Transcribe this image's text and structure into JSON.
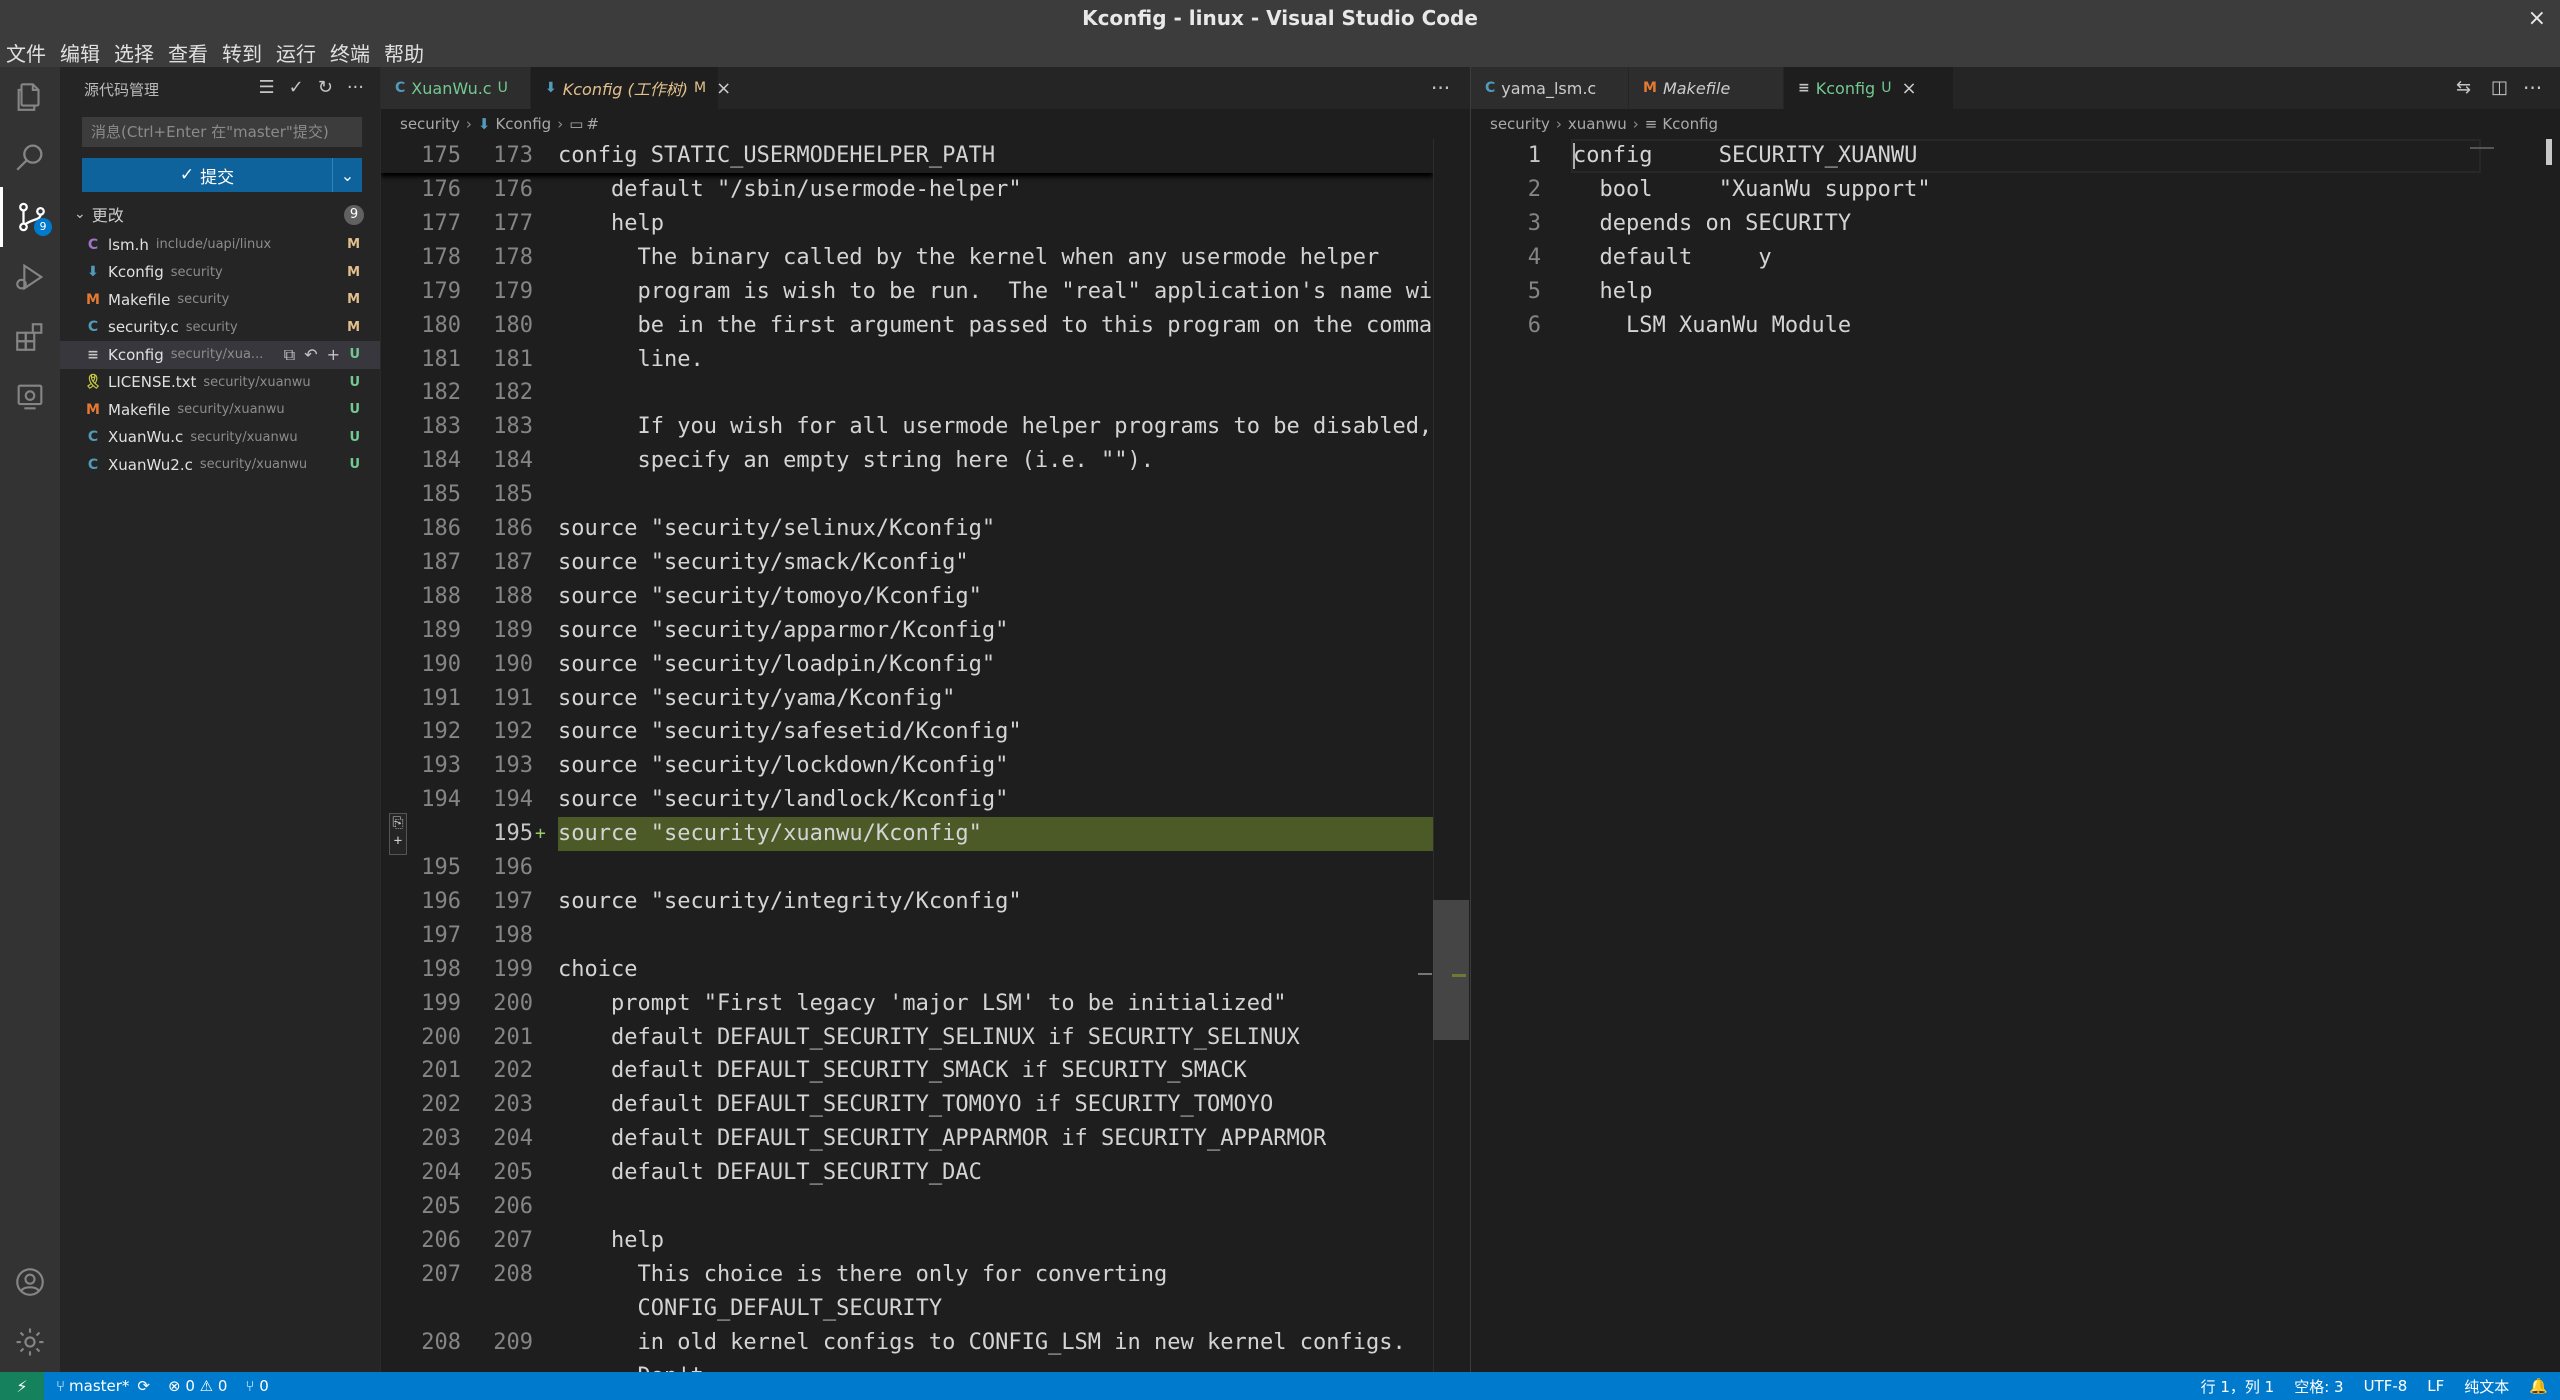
{
  "window": {
    "title": "Kconfig - linux - Visual Studio Code",
    "close_glyph": "×"
  },
  "menu": [
    "文件",
    "编辑",
    "选择",
    "查看",
    "转到",
    "运行",
    "终端",
    "帮助"
  ],
  "activity": {
    "items": [
      {
        "name": "explorer-icon"
      },
      {
        "name": "search-icon"
      },
      {
        "name": "source-control-icon",
        "badge": "9"
      },
      {
        "name": "run-debug-icon"
      },
      {
        "name": "extensions-icon"
      },
      {
        "name": "remote-explorer-icon"
      }
    ],
    "bottom": [
      {
        "name": "account-icon"
      },
      {
        "name": "manage-gear-icon"
      }
    ]
  },
  "scm": {
    "title": "源代码管理",
    "message_placeholder": "消息(Ctrl+Enter 在\"master\"提交)",
    "commit_label": "提交",
    "commit_check": "✓",
    "changes_label": "更改",
    "changes_count": "9",
    "files": [
      {
        "icon": "C",
        "icon_color": "#a074c4",
        "name": "lsm.h",
        "dir": "include/uapi/linux",
        "status": "M"
      },
      {
        "icon": "⬇",
        "icon_color": "#519aba",
        "name": "Kconfig",
        "dir": "security",
        "status": "M"
      },
      {
        "icon": "M",
        "icon_color": "#e37933",
        "name": "Makefile",
        "dir": "security",
        "status": "M"
      },
      {
        "icon": "C",
        "icon_color": "#519aba",
        "name": "security.c",
        "dir": "security",
        "status": "M"
      },
      {
        "icon": "≡",
        "icon_color": "#c5c5c5",
        "name": "Kconfig",
        "dir": "security/xua...",
        "status": "U",
        "selected": true
      },
      {
        "icon": "🎗",
        "icon_color": "#cbcb41",
        "name": "LICENSE.txt",
        "dir": "security/xuanwu",
        "status": "U"
      },
      {
        "icon": "M",
        "icon_color": "#e37933",
        "name": "Makefile",
        "dir": "security/xuanwu",
        "status": "U"
      },
      {
        "icon": "C",
        "icon_color": "#519aba",
        "name": "XuanWu.c",
        "dir": "security/xuanwu",
        "status": "U"
      },
      {
        "icon": "C",
        "icon_color": "#519aba",
        "name": "XuanWu2.c",
        "dir": "security/xuanwu",
        "status": "U"
      }
    ]
  },
  "left_group": {
    "tabs": [
      {
        "icon": "C",
        "icon_color": "#519aba",
        "label": "XuanWu.c",
        "status": "U",
        "status_color": "#73c991",
        "label_color": "#73c991"
      },
      {
        "icon": "⬇",
        "icon_color": "#519aba",
        "label": "Kconfig (工作树)",
        "status": "M",
        "status_color": "#e2c08d",
        "label_color": "#e2c08d",
        "active": true,
        "italic": true
      }
    ],
    "more": "···",
    "breadcrumbs": [
      "security",
      "Kconfig",
      "#"
    ],
    "sticky": {
      "left": "175",
      "right": "173",
      "code": "config STATIC_USERMODEHELPER_PATH"
    },
    "lines": [
      {
        "l": "176",
        "r": "176",
        "code": "    default \"/sbin/usermode-helper\""
      },
      {
        "l": "177",
        "r": "177",
        "code": "    help"
      },
      {
        "l": "178",
        "r": "178",
        "code": "      The binary called by the kernel when any usermode helper"
      },
      {
        "l": "179",
        "r": "179",
        "code": "      program is wish to be run.  The \"real\" application's name will"
      },
      {
        "l": "180",
        "r": "180",
        "code": "      be in the first argument passed to this program on the command"
      },
      {
        "l": "181",
        "r": "181",
        "code": "      line."
      },
      {
        "l": "182",
        "r": "182",
        "code": ""
      },
      {
        "l": "183",
        "r": "183",
        "code": "      If you wish for all usermode helper programs to be disabled,"
      },
      {
        "l": "184",
        "r": "184",
        "code": "      specify an empty string here (i.e. \"\")."
      },
      {
        "l": "185",
        "r": "185",
        "code": ""
      },
      {
        "l": "186",
        "r": "186",
        "code": "source \"security/selinux/Kconfig\""
      },
      {
        "l": "187",
        "r": "187",
        "code": "source \"security/smack/Kconfig\""
      },
      {
        "l": "188",
        "r": "188",
        "code": "source \"security/tomoyo/Kconfig\""
      },
      {
        "l": "189",
        "r": "189",
        "code": "source \"security/apparmor/Kconfig\""
      },
      {
        "l": "190",
        "r": "190",
        "code": "source \"security/loadpin/Kconfig\""
      },
      {
        "l": "191",
        "r": "191",
        "code": "source \"security/yama/Kconfig\""
      },
      {
        "l": "192",
        "r": "192",
        "code": "source \"security/safesetid/Kconfig\""
      },
      {
        "l": "193",
        "r": "193",
        "code": "source \"security/lockdown/Kconfig\""
      },
      {
        "l": "194",
        "r": "194",
        "code": "source \"security/landlock/Kconfig\""
      },
      {
        "l": "",
        "r": "195",
        "code": "source \"security/xuanwu/Kconfig\"",
        "added": true,
        "marker": "+"
      },
      {
        "l": "195",
        "r": "196",
        "code": ""
      },
      {
        "l": "196",
        "r": "197",
        "code": "source \"security/integrity/Kconfig\""
      },
      {
        "l": "197",
        "r": "198",
        "code": ""
      },
      {
        "l": "198",
        "r": "199",
        "code": "choice"
      },
      {
        "l": "199",
        "r": "200",
        "code": "    prompt \"First legacy 'major LSM' to be initialized\""
      },
      {
        "l": "200",
        "r": "201",
        "code": "    default DEFAULT_SECURITY_SELINUX if SECURITY_SELINUX"
      },
      {
        "l": "201",
        "r": "202",
        "code": "    default DEFAULT_SECURITY_SMACK if SECURITY_SMACK"
      },
      {
        "l": "202",
        "r": "203",
        "code": "    default DEFAULT_SECURITY_TOMOYO if SECURITY_TOMOYO"
      },
      {
        "l": "203",
        "r": "204",
        "code": "    default DEFAULT_SECURITY_APPARMOR if SECURITY_APPARMOR"
      },
      {
        "l": "204",
        "r": "205",
        "code": "    default DEFAULT_SECURITY_DAC"
      },
      {
        "l": "205",
        "r": "206",
        "code": ""
      },
      {
        "l": "206",
        "r": "207",
        "code": "    help"
      },
      {
        "l": "207",
        "r": "208",
        "code": "      This choice is there only for converting"
      },
      {
        "l": "",
        "r": "",
        "code": "      CONFIG_DEFAULT_SECURITY"
      },
      {
        "l": "208",
        "r": "209",
        "code": "      in old kernel configs to CONFIG_LSM in new kernel configs."
      },
      {
        "l": "",
        "r": "",
        "code": "      Don't"
      }
    ]
  },
  "right_group": {
    "tabs": [
      {
        "icon": "C",
        "icon_color": "#519aba",
        "label": "yama_lsm.c",
        "label_color": "#cccccc"
      },
      {
        "icon": "M",
        "icon_color": "#e37933",
        "label": "Makefile",
        "label_color": "#cccccc",
        "italic": true
      },
      {
        "icon": "≡",
        "icon_color": "#c5c5c5",
        "label": "Kconfig",
        "status": "U",
        "status_color": "#73c991",
        "label_color": "#73c991",
        "active": true,
        "close": "×"
      }
    ],
    "breadcrumbs": [
      "security",
      "xuanwu",
      "Kconfig"
    ],
    "lines": [
      {
        "n": "1",
        "code": "config     SECURITY_XUANWU"
      },
      {
        "n": "2",
        "code": "  bool     \"XuanWu support\""
      },
      {
        "n": "3",
        "code": "  depends on SECURITY"
      },
      {
        "n": "4",
        "code": "  default     y"
      },
      {
        "n": "5",
        "code": "  help"
      },
      {
        "n": "6",
        "code": "    LSM XuanWu Module"
      }
    ]
  },
  "status": {
    "remote": "⚡",
    "branch": "master*",
    "sync": "⟳",
    "problems": "⊗ 0 ⚠ 0",
    "ports": "⑂ 0",
    "position": "行 1，列 1",
    "spaces": "空格: 3",
    "encoding": "UTF-8",
    "eol": "LF",
    "language": "纯文本",
    "bell": "🔔"
  }
}
